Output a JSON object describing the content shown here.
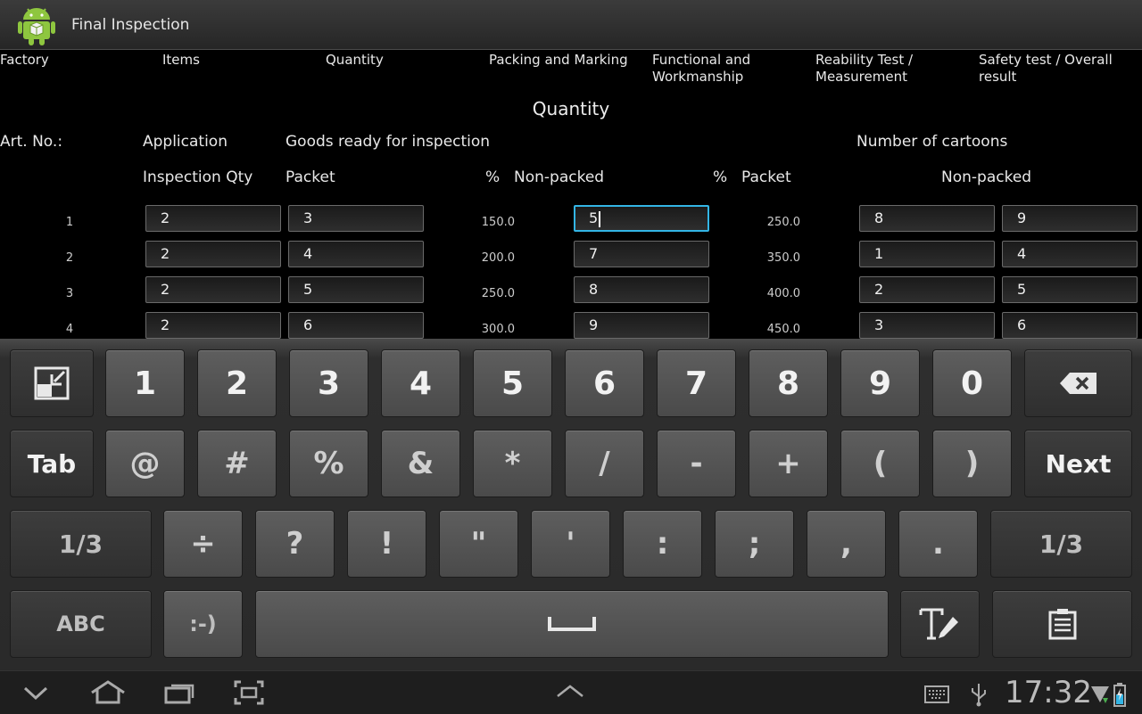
{
  "app": {
    "title": "Final Inspection",
    "icon": "android-app-icon"
  },
  "tabs": [
    {
      "label": "Factory"
    },
    {
      "label": "Items"
    },
    {
      "label": "Quantity"
    },
    {
      "label": "Packing and Marking"
    },
    {
      "label": "Functional and Workmanship"
    },
    {
      "label": "Reability Test / Measurement"
    },
    {
      "label": "Safety test / Overall result"
    }
  ],
  "section": {
    "title": "Quantity"
  },
  "headers": {
    "art_no": "Art. No.:",
    "application": "Application",
    "goods_ready": "Goods ready for inspection",
    "num_cartoons": "Number of cartoons",
    "inspection_qty": "Inspection Qty",
    "packet": "Packet",
    "pct1": "%",
    "non_packed": "Non-packed",
    "pct2": "%",
    "packet2": "Packet",
    "non_packed2": "Non-packed"
  },
  "rows": [
    {
      "num": "1",
      "inspection_qty": "2",
      "packet": "3",
      "pct1": "150.0",
      "non_packed": "5",
      "pct2": "250.0",
      "carton_packet": "8",
      "carton_non_packed": "9"
    },
    {
      "num": "2",
      "inspection_qty": "2",
      "packet": "4",
      "pct1": "200.0",
      "non_packed": "7",
      "pct2": "350.0",
      "carton_packet": "1",
      "carton_non_packed": "4"
    },
    {
      "num": "3",
      "inspection_qty": "2",
      "packet": "5",
      "pct1": "250.0",
      "non_packed": "8",
      "pct2": "400.0",
      "carton_packet": "2",
      "carton_non_packed": "5"
    },
    {
      "num": "4",
      "inspection_qty": "2",
      "packet": "6",
      "pct1": "300.0",
      "non_packed": "9",
      "pct2": "450.0",
      "carton_packet": "3",
      "carton_non_packed": "6"
    }
  ],
  "keyboard": {
    "row1": [
      "1",
      "2",
      "3",
      "4",
      "5",
      "6",
      "7",
      "8",
      "9",
      "0"
    ],
    "row2": [
      "@",
      "#",
      "%",
      "&",
      "*",
      "/",
      "-",
      "+",
      "(",
      ")"
    ],
    "row3": [
      "÷",
      "?",
      "!",
      "\"",
      "'",
      ":",
      ";",
      ",",
      "."
    ],
    "tab_label": "Tab",
    "next_label": "Next",
    "page_label_left": "1/3",
    "page_label_right": "1/3",
    "abc_label": "ABC",
    "smiley_label": ":-)"
  },
  "status": {
    "time": "17:32"
  }
}
